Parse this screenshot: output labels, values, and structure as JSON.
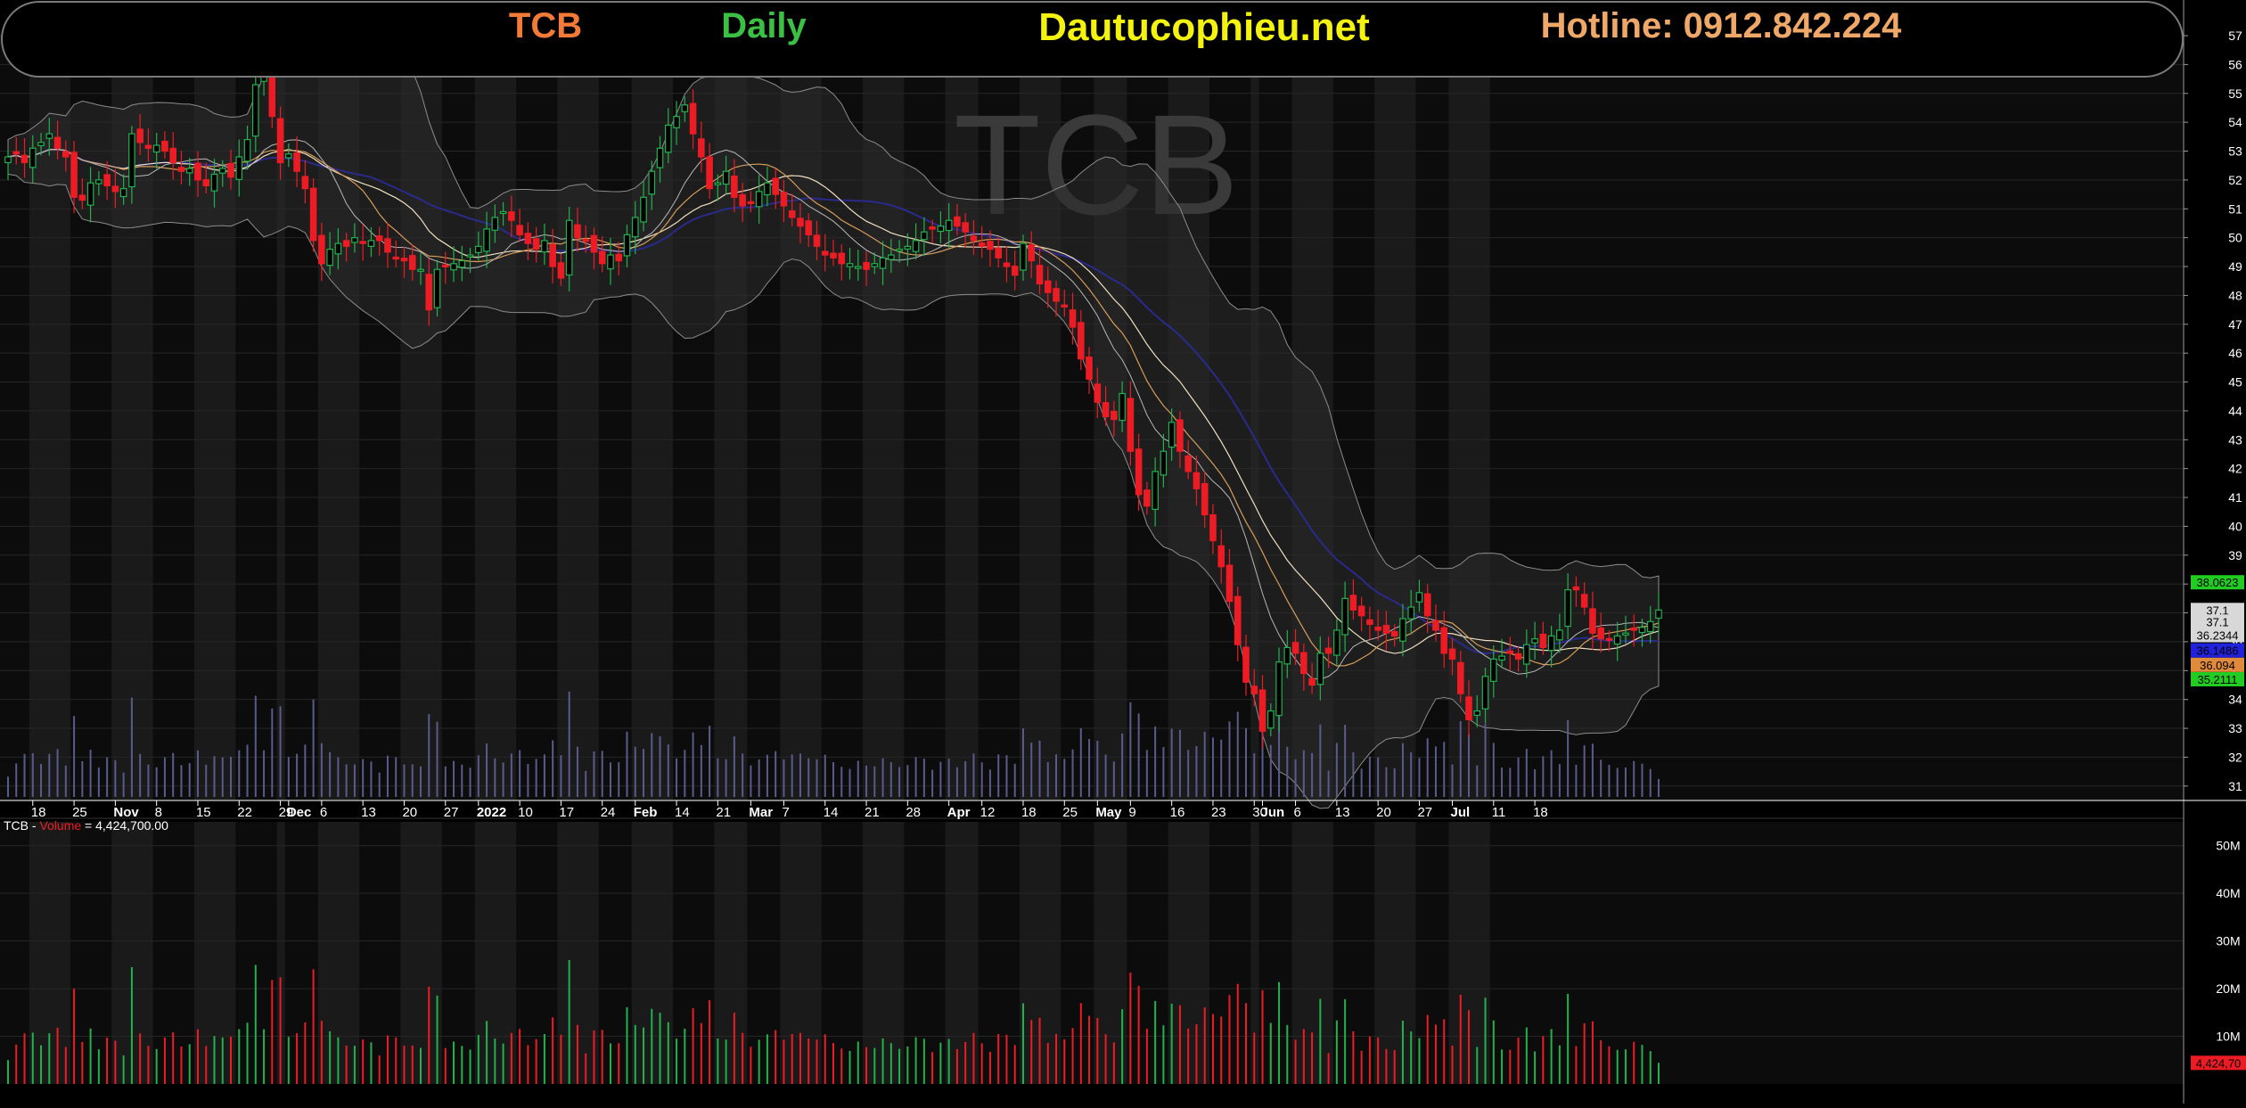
{
  "banner": {
    "symbol": "TCB",
    "period": "Daily",
    "site": "Dautucophieu.net",
    "hotline": "Hotline: 0912.842.224"
  },
  "watermark": "TCB",
  "volume_label": {
    "symbol": "TCB",
    "sep": " - ",
    "name": "Volume",
    "eq": " = ",
    "value": "4,424,700.00"
  },
  "colors": {
    "background": "#000000",
    "up": "#22b14c",
    "down": "#ed1c24",
    "band": "#8c8c8c",
    "ma_fast": "#d79c5a",
    "ma_mid": "#f0e0c0",
    "ma_slow": "#2a2a8c",
    "volume_bar_price_pane": "#5a5a8c"
  },
  "chart_data": [
    {
      "type": "candlestick",
      "title": "TCB Daily",
      "xlabel": "",
      "ylabel": "",
      "ylim": [
        30.5,
        57
      ],
      "yticks": [
        31,
        32,
        33,
        34,
        35,
        36,
        37,
        38,
        39,
        40,
        41,
        42,
        43,
        44,
        45,
        46,
        47,
        48,
        49,
        50,
        51,
        52,
        53,
        54,
        55,
        56,
        57
      ],
      "grid": true,
      "x_tick_labels": [
        "18",
        "25",
        "Nov",
        "8",
        "15",
        "22",
        "29",
        "Dec",
        "6",
        "13",
        "20",
        "27",
        "2022",
        "10",
        "17",
        "24",
        "Feb",
        "14",
        "21",
        "Mar",
        "7",
        "14",
        "21",
        "28",
        "Apr",
        "12",
        "18",
        "25",
        "May",
        "9",
        "16",
        "23",
        "30",
        "Jun",
        "6",
        "13",
        "20",
        "27",
        "Jul",
        "11",
        "18"
      ],
      "x_tick_positions": [
        3,
        8,
        13,
        18,
        23,
        28,
        33,
        34,
        38,
        43,
        48,
        53,
        57,
        62,
        67,
        72,
        76,
        81,
        86,
        90,
        94,
        99,
        104,
        109,
        114,
        118,
        123,
        128,
        132,
        136,
        141,
        146,
        151,
        152,
        156,
        161,
        166,
        171,
        175,
        180,
        185
      ],
      "price_tags": [
        {
          "label": "38.0623",
          "value": 38.06,
          "color": "#22cc22"
        },
        {
          "label": "37.1",
          "value": 37.1,
          "color": "#d8d8d8"
        },
        {
          "label": "37.1",
          "value": 36.7,
          "color": "#d8d8d8"
        },
        {
          "label": "36.2344",
          "value": 36.23,
          "color": "#d8d8d8"
        },
        {
          "label": "36.1486",
          "value": 35.7,
          "color": "#2222dd"
        },
        {
          "label": "36.094",
          "value": 35.2,
          "color": "#e08a3c"
        },
        {
          "label": "35.2111",
          "value": 34.7,
          "color": "#22cc22"
        }
      ],
      "right_side_marks": [
        "37"
      ],
      "close": [
        52.8,
        52.9,
        52.6,
        53.1,
        53.3,
        53.6,
        53.1,
        52.8,
        51.4,
        51.3,
        51.9,
        52.0,
        51.8,
        51.6,
        51.7,
        53.6,
        53.3,
        53.1,
        53.2,
        53.0,
        52.6,
        52.3,
        52.4,
        52.0,
        51.8,
        52.2,
        52.4,
        52.1,
        52.8,
        53.4,
        55.3,
        55.9,
        54.2,
        52.6,
        52.9,
        52.3,
        51.7,
        49.9,
        49.1,
        49.6,
        49.8,
        49.7,
        50.0,
        49.8,
        49.9,
        49.9,
        49.5,
        49.3,
        49.2,
        48.9,
        48.9,
        47.5,
        48.9,
        49.0,
        49.1,
        49.2,
        49.4,
        49.7,
        50.3,
        50.7,
        50.9,
        50.6,
        50.1,
        49.8,
        49.6,
        49.9,
        49.0,
        48.6,
        50.6,
        50.0,
        49.9,
        49.5,
        49.1,
        49.4,
        49.2,
        50.1,
        50.7,
        51.4,
        52.3,
        53.1,
        53.9,
        54.2,
        54.6,
        53.6,
        52.8,
        51.7,
        51.9,
        52.3,
        51.4,
        51.1,
        51.2,
        51.6,
        51.9,
        51.5,
        51.1,
        50.7,
        50.4,
        50.1,
        49.7,
        49.4,
        49.3,
        49.1,
        49.1,
        49.0,
        48.9,
        49.1,
        49.3,
        49.4,
        49.6,
        49.7,
        49.9,
        50.2,
        50.3,
        50.4,
        50.6,
        50.4,
        50.2,
        49.9,
        49.7,
        49.6,
        49.3,
        49.0,
        48.7,
        49.8,
        49.2,
        48.4,
        48.1,
        47.8,
        47.6,
        46.9,
        45.8,
        45.1,
        44.3,
        43.8,
        43.7,
        44.6,
        42.6,
        41.1,
        40.7,
        41.9,
        42.6,
        43.6,
        42.6,
        41.9,
        41.3,
        40.4,
        39.5,
        38.6,
        37.4,
        35.9,
        34.6,
        34.2,
        32.9,
        33.6,
        35.3,
        35.8,
        35.6,
        34.9,
        34.5,
        35.6,
        35.6,
        36.4,
        37.5,
        37.1,
        36.9,
        36.6,
        36.4,
        36.3,
        36.2,
        36.8,
        37.2,
        37.7,
        36.9,
        36.4,
        35.6,
        35.4,
        34.2,
        33.3,
        33.6,
        34.8,
        35.4,
        35.5,
        35.6,
        35.4,
        35.9,
        36.1,
        35.8,
        36.2,
        36.4,
        37.8,
        37.8,
        37.2,
        36.3,
        36.1,
        36.1,
        36.2,
        36.3,
        36.4,
        36.5,
        36.7,
        37.1
      ]
    },
    {
      "type": "bar",
      "title": "",
      "ylabel": "",
      "ylim": [
        0,
        55
      ],
      "yticks": [
        10,
        20,
        30,
        40,
        50
      ],
      "ytick_labels": [
        "10M",
        "20M",
        "30M",
        "40M",
        "50M"
      ],
      "last_value_label": "4,424,70",
      "last_value": 4.4247
    }
  ]
}
